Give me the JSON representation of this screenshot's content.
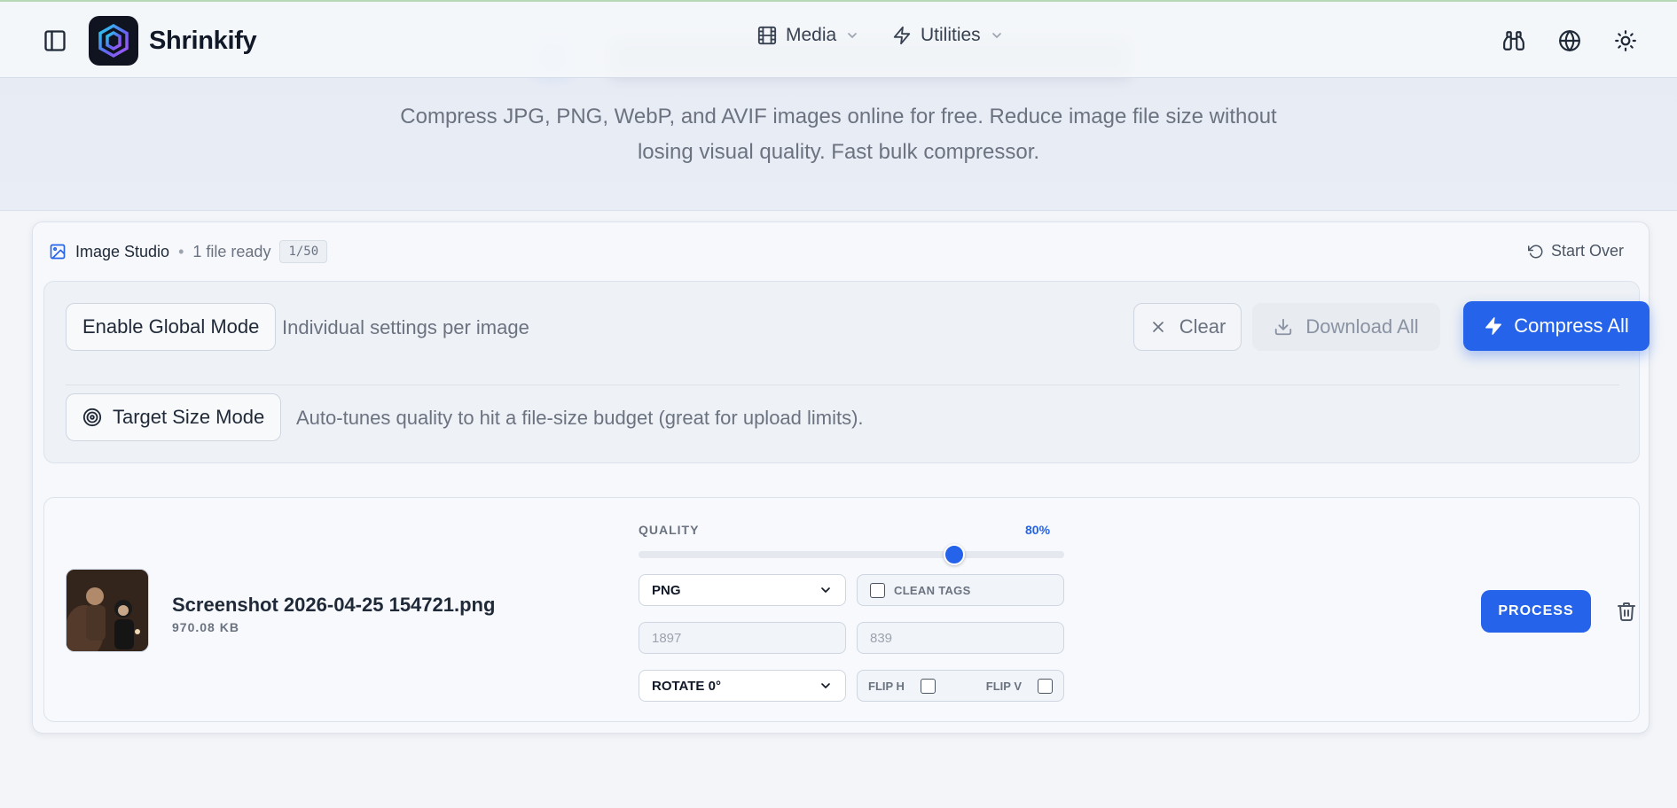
{
  "app": {
    "brand": "Shrinkify"
  },
  "nav": {
    "media_label": "Media",
    "utilities_label": "Utilities"
  },
  "hero": {
    "subtitle_line1": "Compress JPG, PNG, WebP, and AVIF images online for free. Reduce image file size without",
    "subtitle_line2": "losing visual quality. Fast bulk compressor."
  },
  "studio": {
    "title": "Image Studio",
    "separator": "•",
    "ready_text": "1 file ready",
    "count_badge": "1/50",
    "start_over_label": "Start Over"
  },
  "settings": {
    "global_mode_label": "Enable Global Mode",
    "global_mode_note": "Individual settings per image",
    "clear_label": "Clear",
    "download_all_label": "Download All",
    "compress_all_label": "Compress All",
    "target_size_label": "Target Size Mode",
    "target_size_note": "Auto-tunes quality to hit a file-size budget (great for upload limits)."
  },
  "file": {
    "name": "Screenshot 2026-04-25 154721.png",
    "size": "970.08 KB",
    "quality_label": "QUALITY",
    "quality_value_text": "80%",
    "quality_value": 80,
    "format": "PNG",
    "clean_tags_label": "CLEAN TAGS",
    "width_placeholder": "1897",
    "height_placeholder": "839",
    "rotate": "ROTATE 0°",
    "flip_h_label": "FLIP H",
    "flip_v_label": "FLIP V",
    "process_label": "PROCESS"
  },
  "colors": {
    "accent": "#2563eb",
    "background": "#f3f5f9",
    "brand_logo_bg": "#0f1420"
  },
  "icons": {
    "sidebar_toggle": "sidebar-toggle-icon",
    "logo": "shrinkify-logo-icon",
    "media": "film-icon",
    "utilities": "lightning-icon",
    "binoculars": "binoculars-icon",
    "language": "globe-icon",
    "theme": "sun-icon",
    "studio": "image-icon",
    "start_over": "rotate-ccw-icon",
    "target": "target-icon",
    "clear": "close-icon",
    "download": "download-icon",
    "compress": "lightning-icon",
    "delete": "trash-icon"
  }
}
